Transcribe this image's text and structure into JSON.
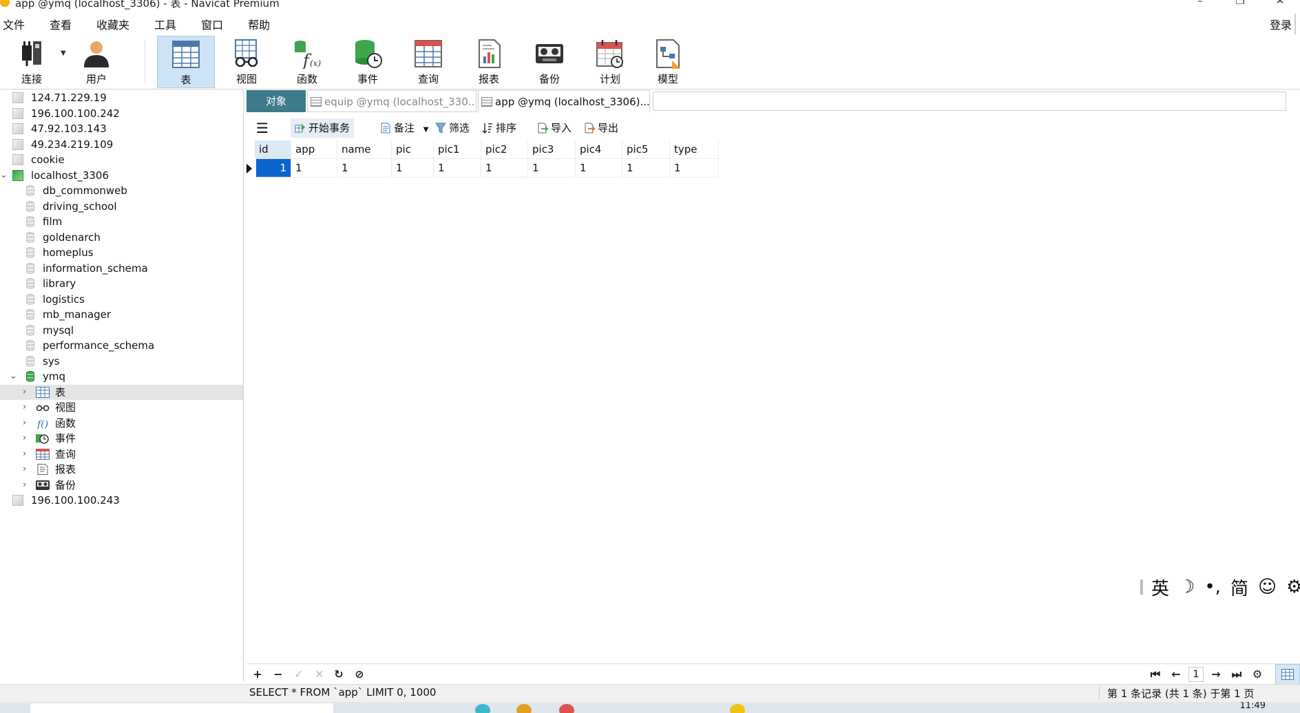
{
  "window": {
    "title": "app @ymq (localhost_3306) - 表 - Navicat Premium"
  },
  "menu": {
    "items": [
      "文件",
      "查看",
      "收藏夹",
      "工具",
      "窗口",
      "帮助"
    ],
    "login": "登录"
  },
  "toolbar": {
    "buttons": [
      {
        "label": "连接",
        "icon": "plug-icon"
      },
      {
        "label": "用户",
        "icon": "user-icon"
      },
      {
        "label": "表",
        "icon": "table-icon",
        "active": true
      },
      {
        "label": "视图",
        "icon": "glasses-icon"
      },
      {
        "label": "函数",
        "icon": "function-icon"
      },
      {
        "label": "事件",
        "icon": "event-clock-icon"
      },
      {
        "label": "查询",
        "icon": "query-icon"
      },
      {
        "label": "报表",
        "icon": "report-icon"
      },
      {
        "label": "备份",
        "icon": "backup-icon"
      },
      {
        "label": "计划",
        "icon": "schedule-calendar-icon"
      },
      {
        "label": "模型",
        "icon": "model-icon"
      }
    ]
  },
  "sidebar": {
    "items": [
      {
        "label": "124.71.229.19",
        "type": "connection"
      },
      {
        "label": "196.100.100.242",
        "type": "connection"
      },
      {
        "label": "47.92.103.143",
        "type": "connection"
      },
      {
        "label": "49.234.219.109",
        "type": "connection"
      },
      {
        "label": "cookie",
        "type": "connection"
      },
      {
        "label": "localhost_3306",
        "type": "connection-open",
        "expanded": true
      },
      {
        "label": "db_commonweb",
        "type": "database"
      },
      {
        "label": "driving_school",
        "type": "database"
      },
      {
        "label": "film",
        "type": "database"
      },
      {
        "label": "goldenarch",
        "type": "database"
      },
      {
        "label": "homeplus",
        "type": "database"
      },
      {
        "label": "information_schema",
        "type": "database"
      },
      {
        "label": "library",
        "type": "database"
      },
      {
        "label": "logistics",
        "type": "database"
      },
      {
        "label": "mb_manager",
        "type": "database"
      },
      {
        "label": "mysql",
        "type": "database"
      },
      {
        "label": "performance_schema",
        "type": "database"
      },
      {
        "label": "sys",
        "type": "database"
      },
      {
        "label": "ymq",
        "type": "database-open",
        "expanded": true
      },
      {
        "label": "表",
        "type": "folder",
        "selected": true
      },
      {
        "label": "视图",
        "type": "folder"
      },
      {
        "label": "函数",
        "type": "folder"
      },
      {
        "label": "事件",
        "type": "folder"
      },
      {
        "label": "查询",
        "type": "folder"
      },
      {
        "label": "报表",
        "type": "folder"
      },
      {
        "label": "备份",
        "type": "folder"
      },
      {
        "label": "196.100.100.243",
        "type": "connection"
      }
    ]
  },
  "tabs": {
    "object": "对象",
    "tab1": "equip @ymq (localhost_330...",
    "tab2": "app @ymq (localhost_3306)..."
  },
  "datatoolbar": {
    "menu_icon": "hamburger-menu-icon",
    "begin_transaction": "开始事务",
    "note": "备注",
    "filter": "筛选",
    "sort": "排序",
    "import": "导入",
    "export": "导出"
  },
  "grid": {
    "columns": [
      "id",
      "app",
      "name",
      "pic",
      "pic1",
      "pic2",
      "pic3",
      "pic4",
      "pic5",
      "type"
    ],
    "rows": [
      [
        "1",
        "1",
        "1",
        "1",
        "1",
        "1",
        "1",
        "1",
        "1",
        "1"
      ]
    ]
  },
  "ime": {
    "lang": "英",
    "moon": "☽",
    "punct": "•,",
    "mode": "简",
    "emoji": "☺",
    "settings": "⚙"
  },
  "bottombar": {
    "page": "1"
  },
  "status": {
    "sql": "SELECT * FROM `app` LIMIT 0, 1000",
    "records": "第 1 条记录 (共 1 条) 于第 1 页"
  },
  "taskbar": {
    "time": "11:49"
  }
}
